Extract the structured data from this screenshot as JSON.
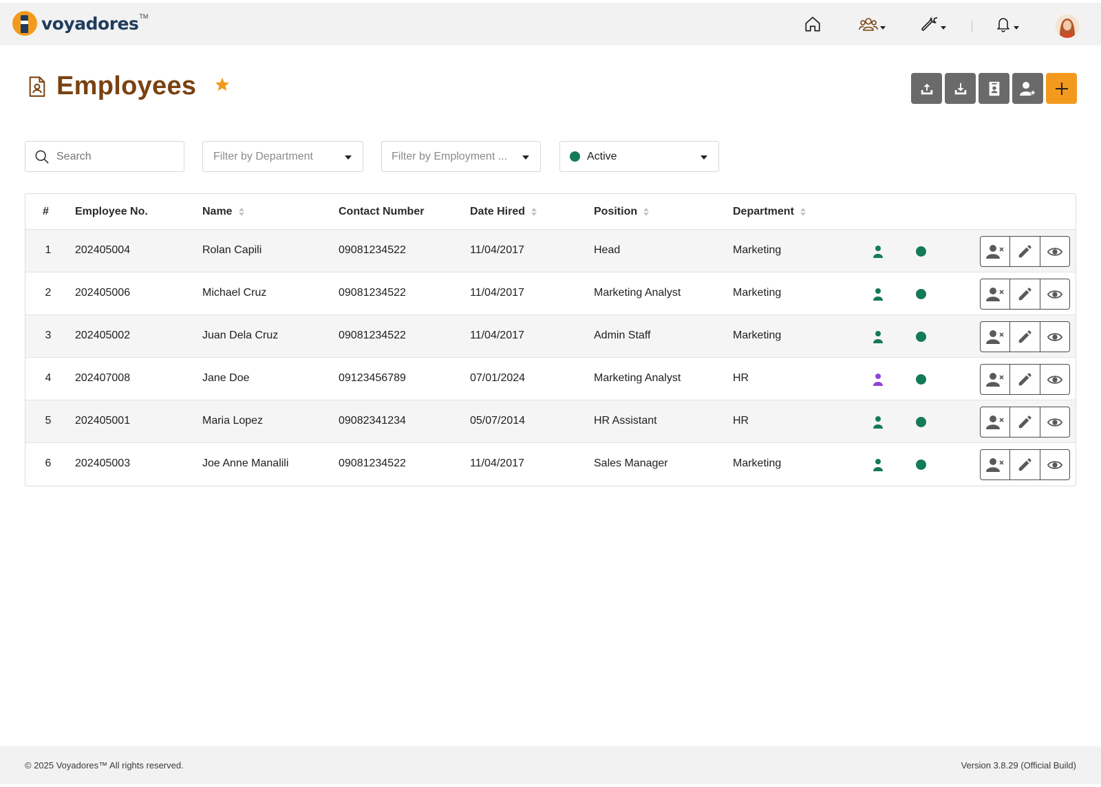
{
  "app": {
    "name": "voyadores",
    "tm": "TM"
  },
  "nav": {
    "home_icon": "home-icon",
    "people_icon": "people-icon",
    "tools_icon": "wrench-icon",
    "notifications_icon": "bell-icon"
  },
  "page": {
    "title": "Employees"
  },
  "filters": {
    "search_placeholder": "Search",
    "department_placeholder": "Filter by Department",
    "employment_placeholder": "Filter by Employment ...",
    "status_value": "Active"
  },
  "table": {
    "headers": {
      "index": "#",
      "employee_no": "Employee No.",
      "name": "Name",
      "contact": "Contact Number",
      "date_hired": "Date Hired",
      "position": "Position",
      "department": "Department"
    },
    "rows": [
      {
        "index": "1",
        "employee_no": "202405004",
        "name": "Rolan Capili",
        "contact": "09081234522",
        "date_hired": "11/04/2017",
        "position": "Head",
        "department": "Marketing",
        "person_color": "#137a5a"
      },
      {
        "index": "2",
        "employee_no": "202405006",
        "name": "Michael Cruz",
        "contact": "09081234522",
        "date_hired": "11/04/2017",
        "position": "Marketing Analyst",
        "department": "Marketing",
        "person_color": "#137a5a"
      },
      {
        "index": "3",
        "employee_no": "202405002",
        "name": "Juan Dela Cruz",
        "contact": "09081234522",
        "date_hired": "11/04/2017",
        "position": "Admin Staff",
        "department": "Marketing",
        "person_color": "#137a5a"
      },
      {
        "index": "4",
        "employee_no": "202407008",
        "name": "Jane Doe",
        "contact": "09123456789",
        "date_hired": "07/01/2024",
        "position": "Marketing Analyst",
        "department": "HR",
        "person_color": "#8e44d6"
      },
      {
        "index": "5",
        "employee_no": "202405001",
        "name": "Maria Lopez",
        "contact": "09082341234",
        "date_hired": "05/07/2014",
        "position": "HR Assistant",
        "department": "HR",
        "person_color": "#137a5a"
      },
      {
        "index": "6",
        "employee_no": "202405003",
        "name": "Joe Anne Manalili",
        "contact": "09081234522",
        "date_hired": "11/04/2017",
        "position": "Sales Manager",
        "department": "Marketing",
        "person_color": "#137a5a"
      }
    ]
  },
  "colors": {
    "accent": "#f39a1e",
    "title": "#7a4212",
    "active": "#137a5a",
    "toolbar": "#6a6a6a"
  },
  "footer": {
    "copyright": "© 2025 Voyadores™ All rights reserved.",
    "version": "Version 3.8.29 (Official Build)"
  }
}
